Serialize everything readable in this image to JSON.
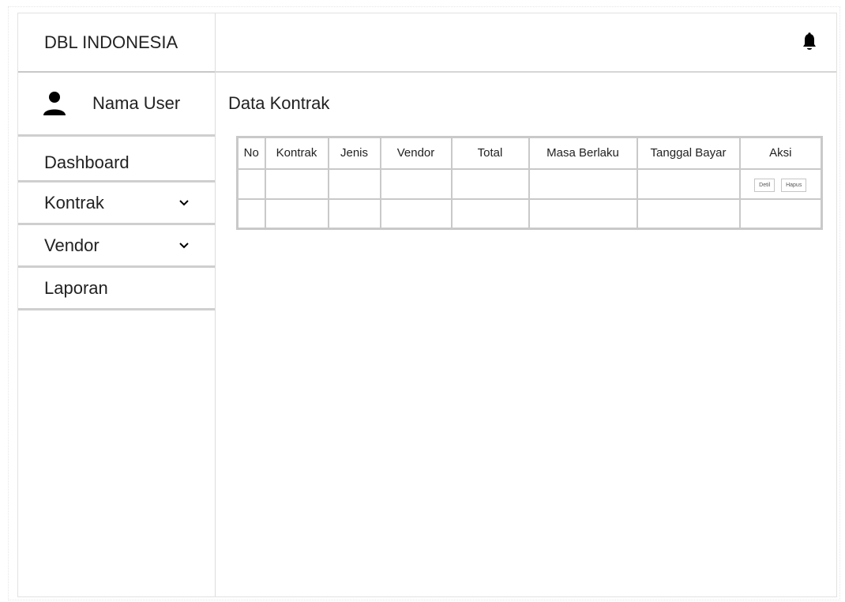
{
  "brand": {
    "title": "DBL INDONESIA"
  },
  "user": {
    "name": "Nama User",
    "icon": "user-icon"
  },
  "sidebar": {
    "items": [
      {
        "label": "Dashboard",
        "has_chevron": false
      },
      {
        "label": "Kontrak",
        "has_chevron": true
      },
      {
        "label": "Vendor",
        "has_chevron": true
      },
      {
        "label": "Laporan",
        "has_chevron": false
      }
    ]
  },
  "header": {
    "notification_icon": "bell-icon"
  },
  "main": {
    "title": "Data Kontrak",
    "table": {
      "columns": [
        "No",
        "Kontrak",
        "Jenis",
        "Vendor",
        "Total",
        "Masa Berlaku",
        "Tanggal Bayar",
        "Aksi"
      ],
      "actions": {
        "detail_label": "Detil",
        "delete_label": "Hapus"
      }
    }
  }
}
